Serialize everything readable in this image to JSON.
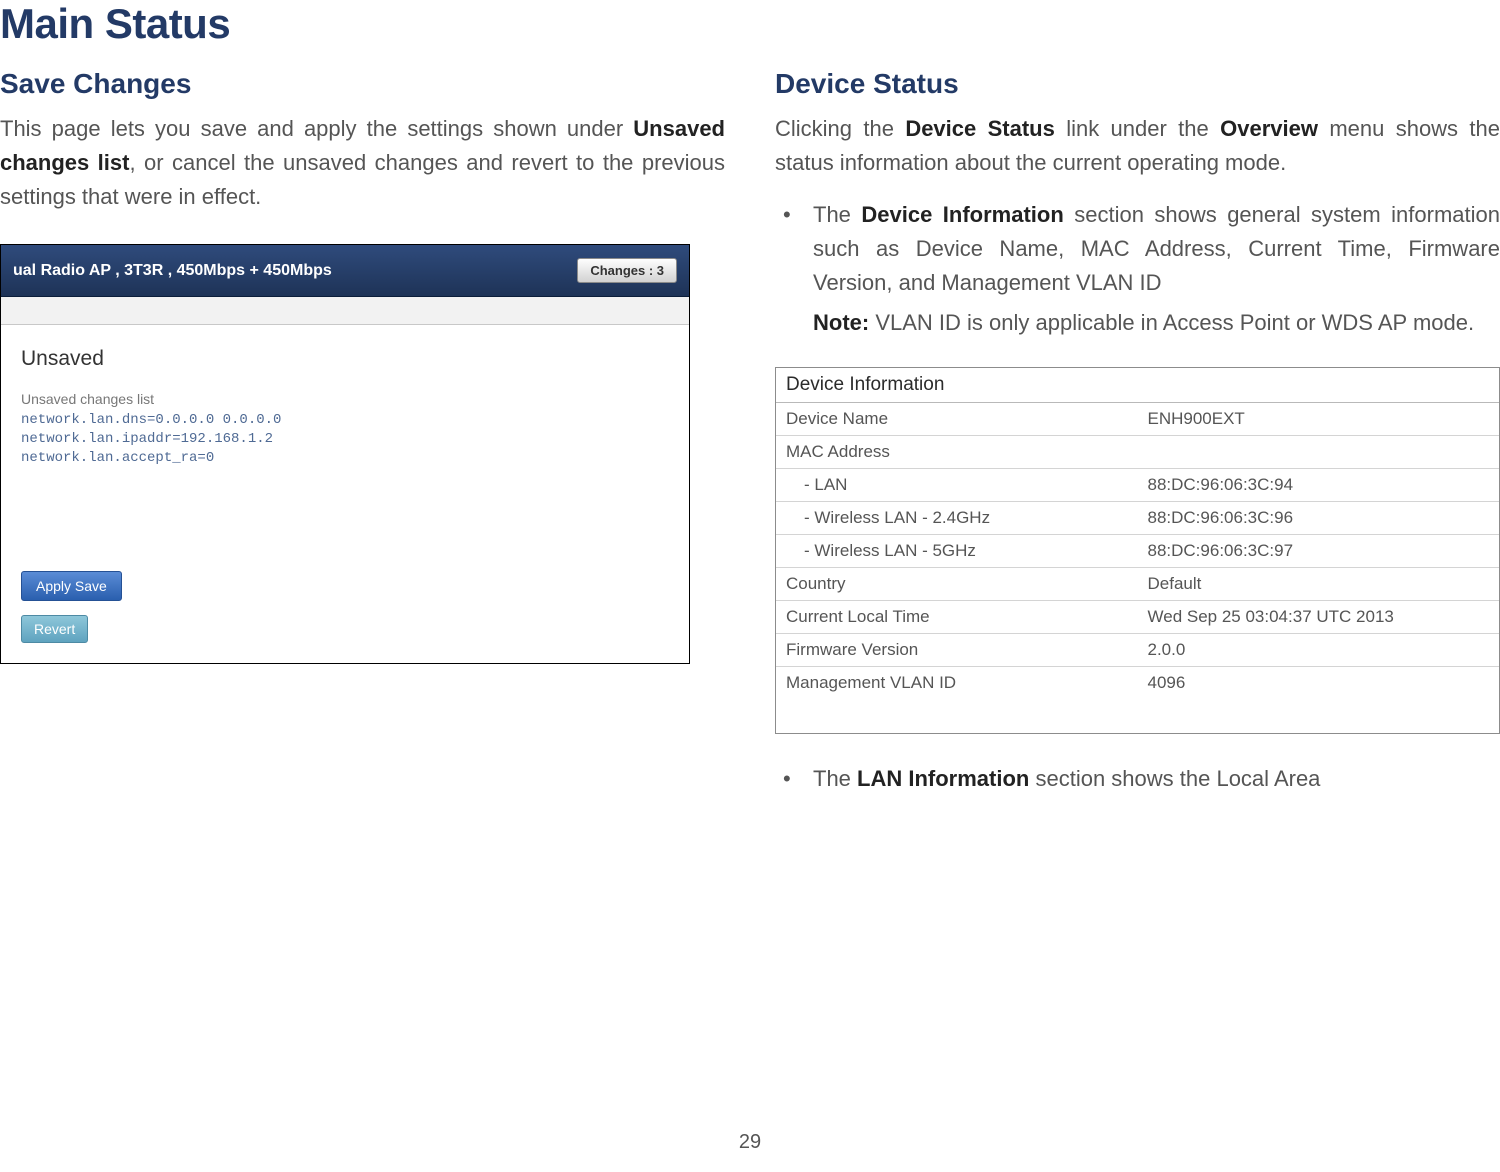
{
  "page_title": "Main Status",
  "page_number": "29",
  "left": {
    "heading": "Save Changes",
    "para_1a": "This page lets you save and apply the settings shown under ",
    "para_1b": "Unsaved changes list",
    "para_1c": ", or cancel the unsaved changes and revert to the previous settings that were in effect.",
    "screenshot": {
      "title_bar": "ual Radio AP , 3T3R , 450Mbps + 450Mbps",
      "changes_button": "Changes : 3",
      "unsaved_heading": "Unsaved",
      "unsaved_list_header": "Unsaved changes list",
      "unsaved_lines": "network.lan.dns=0.0.0.0 0.0.0.0\nnetwork.lan.ipaddr=192.168.1.2\nnetwork.lan.accept_ra=0",
      "apply_button": "Apply Save",
      "revert_button": "Revert"
    }
  },
  "right": {
    "heading": "Device Status",
    "para_1a": "Clicking the ",
    "para_1b": "Device Status",
    "para_1c": " link under the ",
    "para_1d": "Overview",
    "para_1e": " menu shows the status information about the current operating mode.",
    "bullet1_a": "The ",
    "bullet1_b": "Device Information",
    "bullet1_c": " section shows general system information such as Device Name, MAC Address, Current Time, Firmware Version, and Management VLAN ID",
    "note_label": "Note:",
    "note_text": " VLAN ID is only applicable in Access Point or WDS AP mode.",
    "table": {
      "header": "Device Information",
      "rows": [
        {
          "label": "Device Name",
          "value": "ENH900EXT"
        },
        {
          "label": "MAC Address",
          "value": ""
        },
        {
          "label": "- LAN",
          "value": "88:DC:96:06:3C:94",
          "indent": true
        },
        {
          "label": "- Wireless LAN - 2.4GHz",
          "value": "88:DC:96:06:3C:96",
          "indent": true
        },
        {
          "label": "- Wireless LAN - 5GHz",
          "value": "88:DC:96:06:3C:97",
          "indent": true
        },
        {
          "label": "Country",
          "value": "Default"
        },
        {
          "label": "Current Local Time",
          "value": "Wed Sep 25 03:04:37 UTC 2013"
        },
        {
          "label": "Firmware Version",
          "value": "2.0.0"
        },
        {
          "label": "Management VLAN ID",
          "value": "4096"
        }
      ]
    },
    "bullet2_a": "The ",
    "bullet2_b": "LAN Information",
    "bullet2_c": " section shows the Local Area"
  }
}
